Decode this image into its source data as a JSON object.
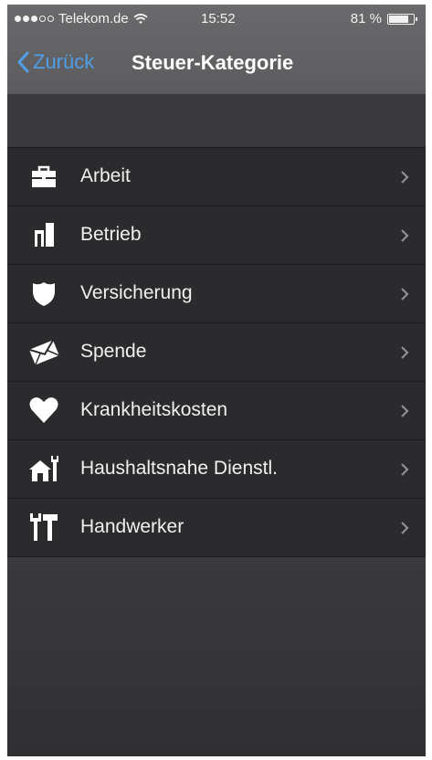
{
  "status": {
    "carrier": "Telekom.de",
    "time": "15:52",
    "battery": "81 %",
    "battery_level": 0.81
  },
  "nav": {
    "back_label": "Zurück",
    "title": "Steuer-Kategorie"
  },
  "colors": {
    "accent": "#4f9fe8",
    "row_bg": "#2b2b2d",
    "text": "#f0f0f0"
  },
  "categories": [
    {
      "label": "Arbeit",
      "icon": "briefcase-icon"
    },
    {
      "label": "Betrieb",
      "icon": "building-icon"
    },
    {
      "label": "Versicherung",
      "icon": "shield-icon"
    },
    {
      "label": "Spende",
      "icon": "envelope-icon"
    },
    {
      "label": "Krankheitskosten",
      "icon": "heart-icon"
    },
    {
      "label": "Haushaltsnahe Dienstl.",
      "icon": "house-tool-icon"
    },
    {
      "label": "Handwerker",
      "icon": "tools-icon"
    }
  ]
}
